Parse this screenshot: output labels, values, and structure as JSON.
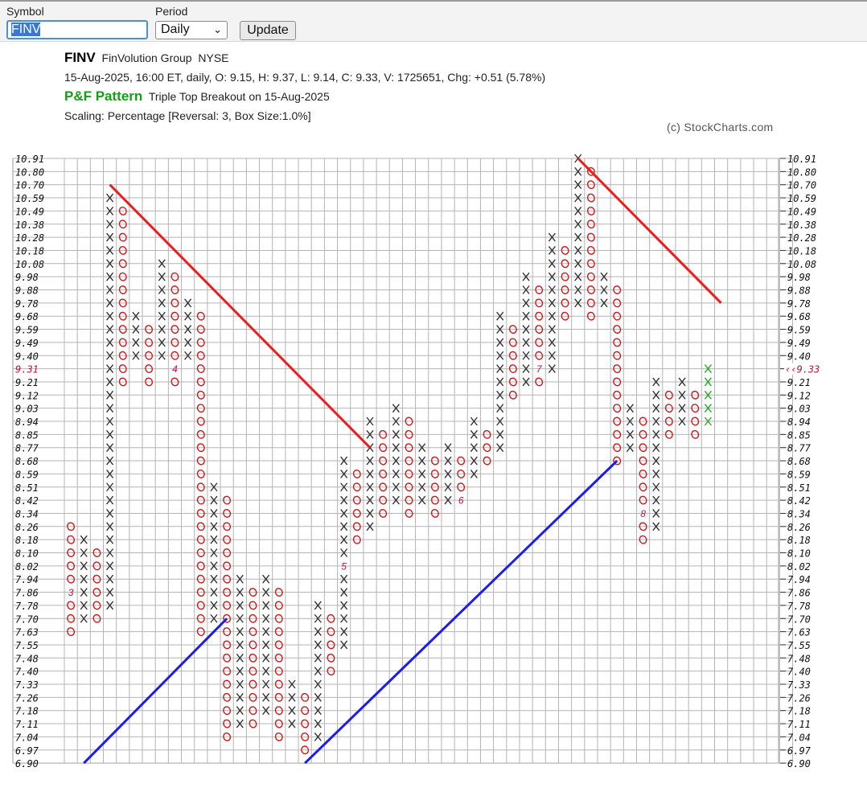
{
  "controls": {
    "symbol_label": "Symbol",
    "symbol_value": "FINV",
    "period_label": "Period",
    "period_value": "Daily",
    "update_label": "Update"
  },
  "header": {
    "ticker": "FINV",
    "company": "FinVolution Group",
    "exchange": "NYSE",
    "quote": "15-Aug-2025, 16:00 ET, daily, O: 9.15, H: 9.37, L: 9.14, C: 9.33, V: 1725651, Chg: +0.51 (5.78%)",
    "pattern_title": "P&F Pattern",
    "pattern_text": "Triple Top Breakout on 15-Aug-2025",
    "scaling": "Scaling: Percentage [Reversal: 3, Box Size:1.0%]",
    "credit": "(c) StockCharts.com"
  },
  "chart_data": {
    "type": "point-and-figure",
    "box_size_pct": 1.0,
    "reversal": 3,
    "ylim": [
      6.9,
      10.91
    ],
    "y_tick_labels": [
      "10.91",
      "10.80",
      "10.70",
      "10.59",
      "10.49",
      "10.38",
      "10.28",
      "10.18",
      "10.08",
      "9.98",
      "9.88",
      "9.78",
      "9.68",
      "9.59",
      "9.49",
      "9.40",
      "9.31",
      "9.21",
      "9.12",
      "9.03",
      "8.94",
      "8.85",
      "8.77",
      "8.68",
      "8.59",
      "8.51",
      "8.42",
      "8.34",
      "8.26",
      "8.18",
      "8.10",
      "8.02",
      "7.94",
      "7.86",
      "7.78",
      "7.70",
      "7.63",
      "7.55",
      "7.48",
      "7.40",
      "7.33",
      "7.26",
      "7.18",
      "7.11",
      "7.04",
      "6.97",
      "6.90"
    ],
    "left_highlight_label": "9.31",
    "last_price_label": "‹‹9.33",
    "colors": {
      "x": "#333333",
      "o": "#d01818",
      "latest_x": "#22aa22",
      "month": "#c0103a",
      "resistance": "#ee1c1c",
      "support": "#1c1cee",
      "grid": "#b4b4b4"
    },
    "columns": [
      {
        "type": "O",
        "top": "8.26",
        "bottom": "7.63",
        "marks": {
          "7.86": "3"
        }
      },
      {
        "type": "X",
        "top": "8.18",
        "bottom": "7.70"
      },
      {
        "type": "O",
        "top": "8.10",
        "bottom": "7.70"
      },
      {
        "type": "X",
        "top": "10.59",
        "bottom": "7.78"
      },
      {
        "type": "O",
        "top": "10.49",
        "bottom": "9.21"
      },
      {
        "type": "X",
        "top": "9.68",
        "bottom": "9.40"
      },
      {
        "type": "O",
        "top": "9.59",
        "bottom": "9.21"
      },
      {
        "type": "X",
        "top": "10.08",
        "bottom": "9.40"
      },
      {
        "type": "O",
        "top": "9.98",
        "bottom": "9.21",
        "marks": {
          "9.31": "4"
        }
      },
      {
        "type": "X",
        "top": "9.78",
        "bottom": "9.40"
      },
      {
        "type": "O",
        "top": "9.68",
        "bottom": "7.63"
      },
      {
        "type": "X",
        "top": "8.51",
        "bottom": "7.70"
      },
      {
        "type": "O",
        "top": "8.42",
        "bottom": "7.04"
      },
      {
        "type": "X",
        "top": "7.94",
        "bottom": "7.11"
      },
      {
        "type": "O",
        "top": "7.86",
        "bottom": "7.11"
      },
      {
        "type": "X",
        "top": "7.94",
        "bottom": "7.18"
      },
      {
        "type": "O",
        "top": "7.86",
        "bottom": "7.04"
      },
      {
        "type": "X",
        "top": "7.33",
        "bottom": "7.11"
      },
      {
        "type": "O",
        "top": "7.26",
        "bottom": "6.97"
      },
      {
        "type": "X",
        "top": "7.78",
        "bottom": "7.04"
      },
      {
        "type": "O",
        "top": "7.70",
        "bottom": "7.40"
      },
      {
        "type": "X",
        "top": "8.68",
        "bottom": "7.55",
        "marks": {
          "8.02": "5"
        }
      },
      {
        "type": "O",
        "top": "8.59",
        "bottom": "8.18"
      },
      {
        "type": "X",
        "top": "8.94",
        "bottom": "8.26"
      },
      {
        "type": "O",
        "top": "8.85",
        "bottom": "8.34"
      },
      {
        "type": "X",
        "top": "9.03",
        "bottom": "8.42"
      },
      {
        "type": "O",
        "top": "8.94",
        "bottom": "8.34"
      },
      {
        "type": "X",
        "top": "8.77",
        "bottom": "8.42"
      },
      {
        "type": "O",
        "top": "8.68",
        "bottom": "8.34"
      },
      {
        "type": "X",
        "top": "8.77",
        "bottom": "8.42"
      },
      {
        "type": "O",
        "top": "8.68",
        "bottom": "8.42",
        "marks": {
          "8.42": "6"
        }
      },
      {
        "type": "X",
        "top": "8.94",
        "bottom": "8.59"
      },
      {
        "type": "O",
        "top": "8.85",
        "bottom": "8.68"
      },
      {
        "type": "X",
        "top": "9.68",
        "bottom": "8.77"
      },
      {
        "type": "O",
        "top": "9.59",
        "bottom": "9.12"
      },
      {
        "type": "X",
        "top": "9.98",
        "bottom": "9.21"
      },
      {
        "type": "O",
        "top": "9.88",
        "bottom": "9.21",
        "marks": {
          "9.31": "7"
        }
      },
      {
        "type": "X",
        "top": "10.28",
        "bottom": "9.31"
      },
      {
        "type": "O",
        "top": "10.18",
        "bottom": "9.68"
      },
      {
        "type": "X",
        "top": "10.91",
        "bottom": "9.78"
      },
      {
        "type": "O",
        "top": "10.80",
        "bottom": "9.68"
      },
      {
        "type": "X",
        "top": "9.98",
        "bottom": "9.78"
      },
      {
        "type": "O",
        "top": "9.88",
        "bottom": "8.68"
      },
      {
        "type": "X",
        "top": "9.03",
        "bottom": "8.77"
      },
      {
        "type": "O",
        "top": "8.94",
        "bottom": "8.18",
        "marks": {
          "8.34": "8"
        }
      },
      {
        "type": "X",
        "top": "9.21",
        "bottom": "8.26"
      },
      {
        "type": "O",
        "top": "9.12",
        "bottom": "8.85"
      },
      {
        "type": "X",
        "top": "9.21",
        "bottom": "8.94"
      },
      {
        "type": "O",
        "top": "9.12",
        "bottom": "8.85"
      },
      {
        "type": "X",
        "top": "9.31",
        "bottom": "8.94",
        "latest": true
      }
    ],
    "trendlines": [
      {
        "kind": "resistance",
        "from": {
          "col": 3,
          "price": "10.70"
        },
        "to": {
          "col": 23,
          "price": "8.77"
        }
      },
      {
        "kind": "support",
        "from": {
          "col": 1,
          "price": "6.90"
        },
        "to": {
          "col": 12,
          "price": "7.70"
        }
      },
      {
        "kind": "support",
        "from": {
          "col": 18,
          "price": "6.90"
        },
        "to": {
          "col": 42,
          "price": "8.68"
        }
      },
      {
        "kind": "resistance",
        "from": {
          "col": 39,
          "price": "10.91"
        },
        "to": {
          "col": 50,
          "price": "9.78"
        }
      }
    ]
  }
}
